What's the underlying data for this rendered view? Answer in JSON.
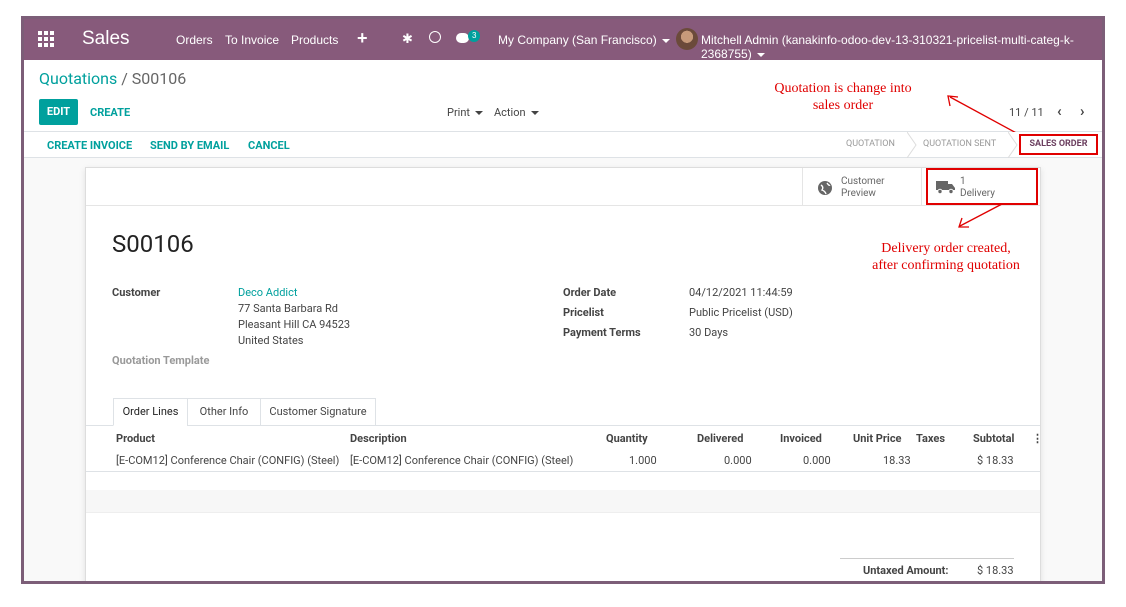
{
  "navbar": {
    "app_name": "Sales",
    "menu": [
      "Orders",
      "To Invoice",
      "Products"
    ],
    "chat_count": "3",
    "company": "My Company (San Francisco)",
    "user": "Mitchell Admin (kanakinfo-odoo-dev-13-310321-pricelist-multi-categ-k-2368755)"
  },
  "breadcrumb": {
    "parent": "Quotations",
    "separator": "/",
    "current": "S00106"
  },
  "control": {
    "edit_label": "EDIT",
    "create_label": "CREATE",
    "print_label": "Print",
    "action_label": "Action",
    "pager": "11 / 11"
  },
  "statusbar": {
    "buttons": [
      "CREATE INVOICE",
      "SEND BY EMAIL",
      "CANCEL"
    ],
    "stages": [
      "QUOTATION",
      "QUOTATION SENT",
      "SALES ORDER"
    ],
    "active_stage": "SALES ORDER"
  },
  "annotations": {
    "top_right": "Quotation is change into\nsales order",
    "delivery": "Delivery order created,\nafter confirming quotation",
    "color": "#e00000"
  },
  "smart_buttons": {
    "preview_line1": "Customer",
    "preview_line2": "Preview",
    "delivery_count": "1",
    "delivery_label": "Delivery"
  },
  "order": {
    "name": "S00106",
    "customer_label": "Customer",
    "customer_name": "Deco Addict",
    "address": [
      "77 Santa Barbara Rd",
      "Pleasant Hill CA 94523",
      "United States"
    ],
    "quotation_template_label": "Quotation Template",
    "order_date_label": "Order Date",
    "order_date": "04/12/2021 11:44:59",
    "pricelist_label": "Pricelist",
    "pricelist": "Public Pricelist (USD)",
    "payment_terms_label": "Payment Terms",
    "payment_terms": "30 Days"
  },
  "tabs": [
    "Order Lines",
    "Other Info",
    "Customer Signature"
  ],
  "lines": {
    "headers": [
      "Product",
      "Description",
      "Quantity",
      "Delivered",
      "Invoiced",
      "Unit Price",
      "Taxes",
      "Subtotal"
    ],
    "rows": [
      {
        "product": "[E-COM12] Conference Chair (CONFIG) (Steel)",
        "description": "[E-COM12] Conference Chair (CONFIG) (Steel)",
        "quantity": "1.000",
        "delivered": "0.000",
        "invoiced": "0.000",
        "unit_price": "18.33",
        "taxes": "",
        "subtotal": "$ 18.33"
      }
    ]
  },
  "totals": {
    "untaxed_label": "Untaxed Amount:",
    "untaxed_value": "$ 18.33"
  },
  "colors": {
    "brand": "#875a7b",
    "accent": "#00a09d"
  }
}
